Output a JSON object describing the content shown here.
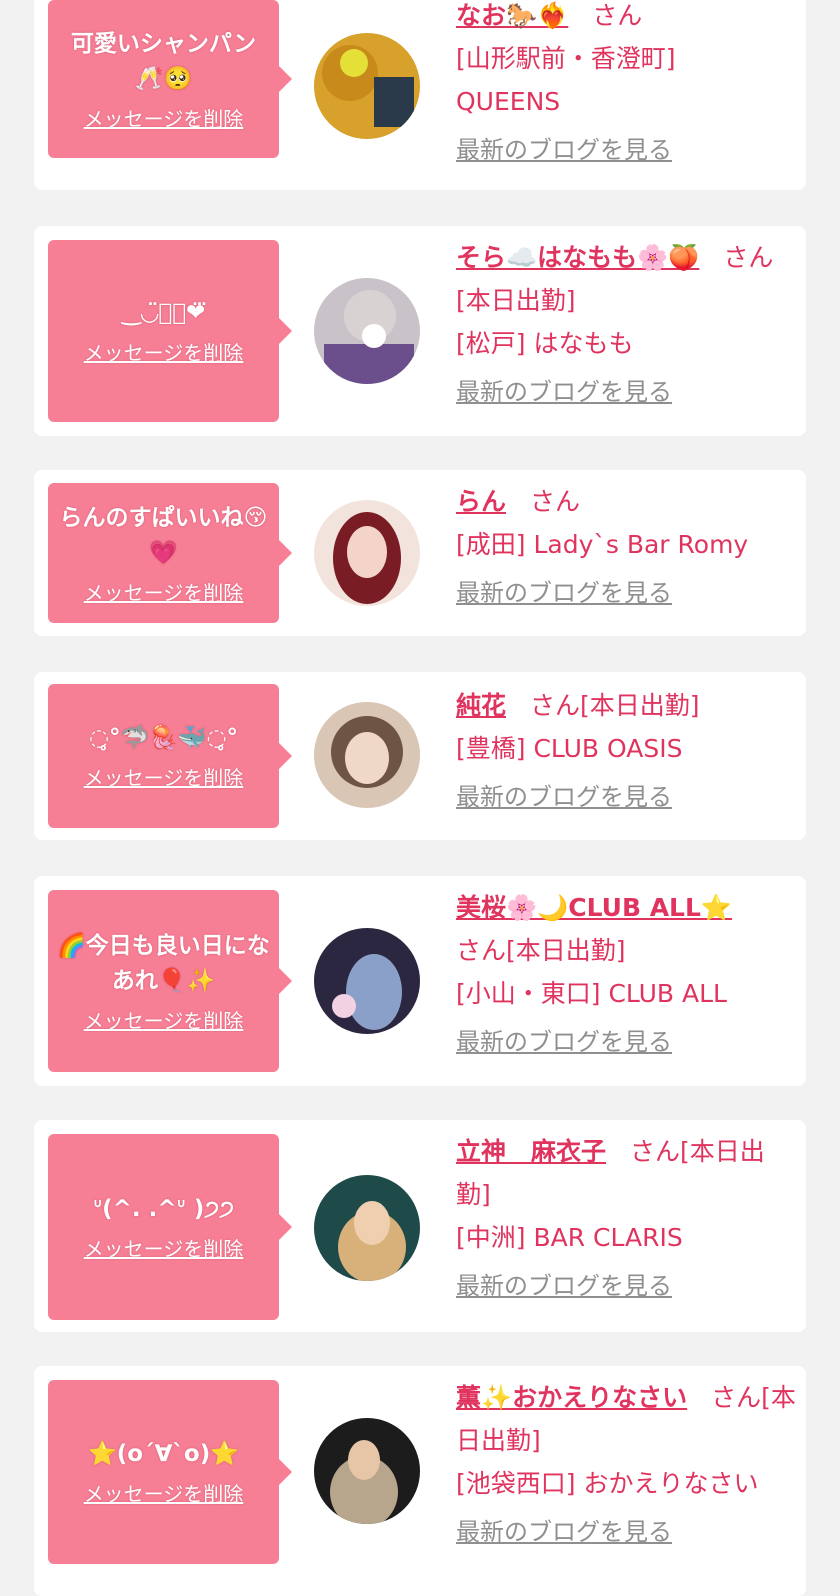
{
  "messages": [
    {
      "bubble_text": "可愛いシャンパン🥂🥺",
      "delete_label": "メッセージを削除",
      "name": "なお🐎❤️‍🔥",
      "san": "さん",
      "status": "",
      "shop": "[山形駅前・香澄町] QUEENS",
      "blog_label": "最新のブログを見る",
      "avatar_colors": [
        "#d8a12c",
        "#2a3a4a"
      ]
    },
    {
      "bubble_text": "‿◡̈⃝⸝❤︎⃛",
      "delete_label": "メッセージを削除",
      "name": "そら☁️はなもも🌸🍑",
      "san": "さん",
      "status": "[本日出勤]",
      "shop": "[松戸] はなもも",
      "blog_label": "最新のブログを見る",
      "avatar_colors": [
        "#c9c2c8",
        "#6a4f8c"
      ]
    },
    {
      "bubble_text": "らんのすぱいいね😚💗",
      "delete_label": "メッセージを削除",
      "name": "らん",
      "san": "さん",
      "status": "",
      "shop": "[成田] Lady`s Bar Romy",
      "blog_label": "最新のブログを見る",
      "avatar_colors": [
        "#f2e4dc",
        "#7a1c24"
      ]
    },
    {
      "bubble_text": "◌̥°🦈🪼🐳◌̥°",
      "delete_label": "メッセージを削除",
      "name": "純花",
      "san": "さん",
      "status": "[本日出勤]",
      "shop": "[豊橋] CLUB OASIS",
      "blog_label": "最新のブログを見る",
      "avatar_colors": [
        "#d9c6b4",
        "#6e5444"
      ]
    },
    {
      "bubble_text": "🌈今日も良い日になあれ🎈✨",
      "delete_label": "メッセージを削除",
      "name": "美桜🌸🌙CLUB ALL⭐️",
      "san": "さん",
      "status": "[本日出勤]",
      "shop": "[小山・東口] CLUB ALL",
      "blog_label": "最新のブログを見る",
      "avatar_colors": [
        "#2b2740",
        "#8aa0c8"
      ]
    },
    {
      "bubble_text": "ᐡ(^. .^ᐡ )੭੭",
      "delete_label": "メッセージを削除",
      "name": "立神　麻衣子",
      "san": "さん",
      "status": "[本日出勤]",
      "shop": "[中洲] BAR CLARIS",
      "blog_label": "最新のブログを見る",
      "avatar_colors": [
        "#1f4a4a",
        "#d8b07a"
      ]
    },
    {
      "bubble_text": "⭐️(o´∀`o)⭐️",
      "delete_label": "メッセージを削除",
      "name": "薫✨おかえりなさい",
      "san": "さん",
      "status": "[本日出勤]",
      "shop": "[池袋西口] おかえりなさい",
      "blog_label": "最新のブログを見る",
      "avatar_colors": [
        "#1c1c1c",
        "#b7a58c"
      ]
    }
  ]
}
